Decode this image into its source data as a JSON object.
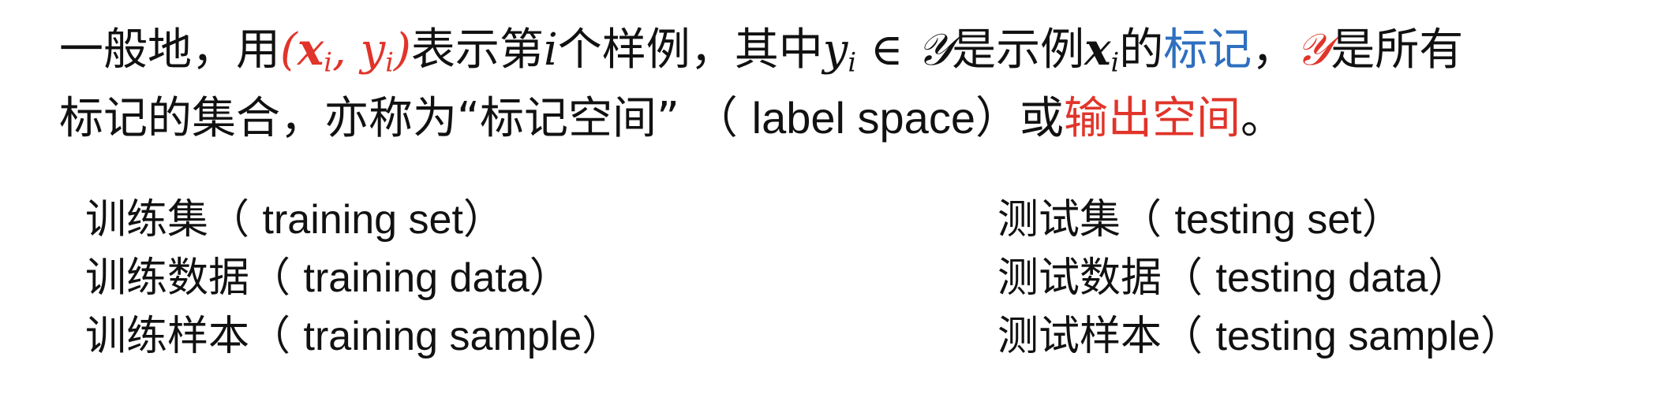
{
  "paragraph": {
    "line1": {
      "t1": "一般地，用",
      "pair_open": "(",
      "x_i": "x",
      "sub_i_1": "i",
      "comma": ", ",
      "y_i_a": "y",
      "sub_i_2": "i",
      "pair_close": ")",
      "t2": "表示第",
      "i_var": "i",
      "t3": "个样例，其中",
      "y_i_b": "y",
      "sub_i_3": "i",
      "in_sym": " ∈ ",
      "Y_set_1": "𝒴",
      "t4": "是示例",
      "x_i_b": "x",
      "sub_i_4": "i",
      "t5": "的",
      "label_term": "标记",
      "t6": "，",
      "Y_set_2": "𝒴",
      "t7": "是所有"
    },
    "line2": {
      "t1": "标记的集合，亦称为“标记空间”",
      "t2": "（ ",
      "label_space_en": "label space",
      "t3": "）或",
      "output_space": "输出空间",
      "t4": "。"
    }
  },
  "training_terms": [
    {
      "zh": "训练集",
      "open": "（ ",
      "en": "training set",
      "close": "）"
    },
    {
      "zh": "训练数据",
      "open": "（ ",
      "en": "training data",
      "close": "）"
    },
    {
      "zh": "训练样本",
      "open": "（ ",
      "en": "training sample",
      "close": "）"
    }
  ],
  "testing_terms": [
    {
      "zh": "测试集",
      "open": "（ ",
      "en": "testing set",
      "close": "）"
    },
    {
      "zh": "测试数据",
      "open": "（ ",
      "en": "testing data",
      "close": "）"
    },
    {
      "zh": "测试样本",
      "open": "（ ",
      "en": "testing sample",
      "close": "）"
    }
  ],
  "colors": {
    "accent_red": "#e1342a",
    "accent_blue": "#2e6fc0",
    "text": "#111111"
  }
}
